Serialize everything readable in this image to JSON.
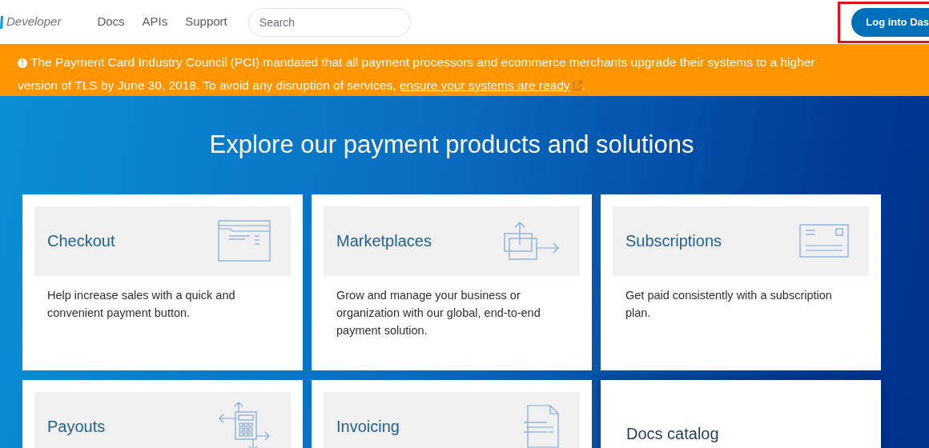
{
  "header": {
    "logo_text": "Developer",
    "nav": [
      {
        "label": "Docs"
      },
      {
        "label": "APIs"
      },
      {
        "label": "Support"
      }
    ],
    "search": {
      "placeholder": "Search"
    },
    "login_button": "Log into Das",
    "highlighted": true
  },
  "banner": {
    "icon": "!",
    "text": "The Payment Card Industry Council (PCI) mandated that all payment processors and ecommerce merchants upgrade their systems to a higher version of TLS by June 30, 2018. To avoid any disruption of services,",
    "link": "ensure your systems are ready",
    "end": "."
  },
  "hero": {
    "title": "Explore our payment products and solutions"
  },
  "cards": [
    {
      "kind": "product",
      "title": "Checkout",
      "description": "Help increase sales with a quick and convenient payment button."
    },
    {
      "kind": "product",
      "title": "Marketplaces",
      "description": "Grow and manage your business or organization with our global, end-to-end payment solution."
    },
    {
      "kind": "product",
      "title": "Subscriptions",
      "description": "Get paid consistently with a subscription plan."
    },
    {
      "kind": "product",
      "title": "Payouts"
    },
    {
      "kind": "product",
      "title": "Invoicing"
    },
    {
      "kind": "catalog",
      "title": "Docs catalog"
    }
  ]
}
